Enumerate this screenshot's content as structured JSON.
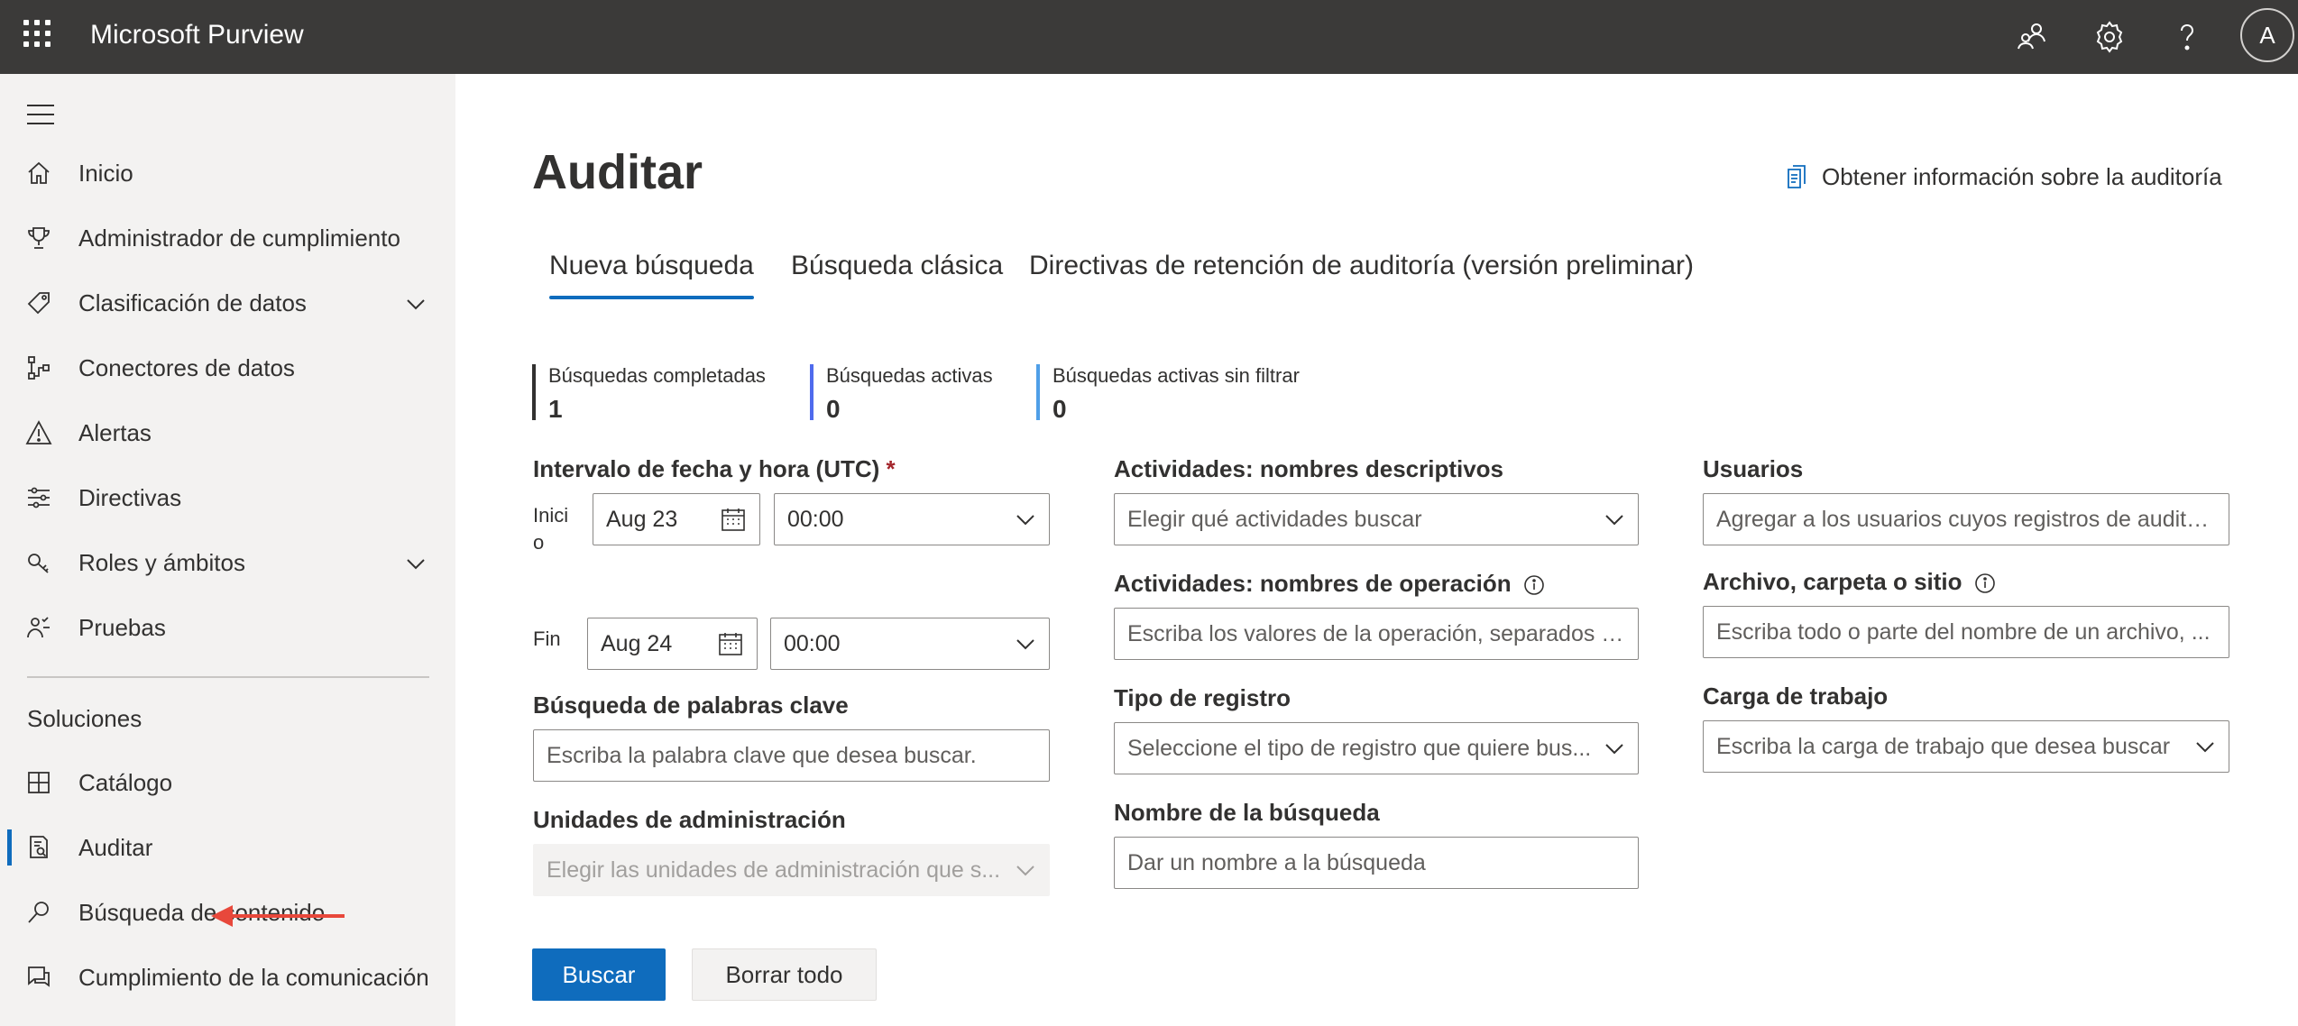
{
  "topbar": {
    "app_title": "Microsoft Purview",
    "icons": [
      "waffle-icon",
      "people-network-icon",
      "settings-gear-icon",
      "help-question-icon"
    ],
    "avatar_initial": "A"
  },
  "sidebar": {
    "items": [
      {
        "label": "Inicio",
        "icon": "home-icon"
      },
      {
        "label": "Administrador de cumplimiento",
        "icon": "trophy-icon"
      },
      {
        "label": "Clasificación de datos",
        "icon": "tag-icon",
        "expandable": true
      },
      {
        "label": "Conectores de datos",
        "icon": "connector-icon"
      },
      {
        "label": "Alertas",
        "icon": "warning-icon"
      },
      {
        "label": "Directivas",
        "icon": "sliders-icon"
      },
      {
        "label": "Roles y ámbitos",
        "icon": "key-icon",
        "expandable": true
      },
      {
        "label": "Pruebas",
        "icon": "trials-icon"
      }
    ],
    "section_label": "Soluciones",
    "solutions": [
      {
        "label": "Catálogo",
        "icon": "catalog-icon"
      },
      {
        "label": "Auditar",
        "icon": "audit-icon",
        "active": true
      },
      {
        "label": "Búsqueda de contenido",
        "icon": "search-icon"
      },
      {
        "label": "Cumplimiento de la comunicación",
        "icon": "chat-icon"
      }
    ]
  },
  "main": {
    "title": "Auditar",
    "learn_link": "Obtener información sobre la auditoría",
    "tabs": [
      {
        "label": "Nueva búsqueda",
        "active": true
      },
      {
        "label": "Búsqueda clásica"
      },
      {
        "label": "Directivas de retención de auditoría (versión preliminar)"
      }
    ],
    "stats": [
      {
        "label": "Búsquedas completadas",
        "value": "1",
        "color": "#323130"
      },
      {
        "label": "Búsquedas activas",
        "value": "0",
        "color": "#4f6bed"
      },
      {
        "label": "Búsquedas activas sin filtrar",
        "value": "0",
        "color": "#4f9fe8"
      }
    ],
    "date_range": {
      "label": "Intervalo de fecha y hora (UTC)",
      "required_mark": "*",
      "start_label": "Inici\no",
      "start_date": "Aug 23",
      "start_time": "00:00",
      "end_label": "Fin",
      "end_date": "Aug 24",
      "end_time": "00:00"
    },
    "keyword": {
      "label": "Búsqueda de palabras clave",
      "placeholder": "Escriba la palabra clave que desea buscar."
    },
    "admin_units": {
      "label": "Unidades de administración",
      "placeholder": "Elegir las unidades de administración que s..."
    },
    "activities_friendly": {
      "label": "Actividades: nombres descriptivos",
      "placeholder": "Elegir qué actividades buscar"
    },
    "activities_operation": {
      "label": "Actividades: nombres de operación",
      "placeholder": "Escriba los valores de la operación, separados p..."
    },
    "record_type": {
      "label": "Tipo de registro",
      "placeholder": "Seleccione el tipo de registro que quiere bus..."
    },
    "search_name": {
      "label": "Nombre de la búsqueda",
      "placeholder": "Dar un nombre a la búsqueda"
    },
    "users": {
      "label": "Usuarios",
      "placeholder": "Agregar a los usuarios cuyos registros de audito..."
    },
    "file_folder": {
      "label": "Archivo, carpeta o sitio",
      "placeholder": "Escriba todo o parte del nombre de un archivo, ..."
    },
    "workload": {
      "label": "Carga de trabajo",
      "placeholder": "Escriba la carga de trabajo que desea buscar"
    },
    "buttons": {
      "search": "Buscar",
      "clear": "Borrar todo"
    }
  },
  "colors": {
    "accent": "#0f6cbd",
    "topbar": "#3b3a39",
    "sidebar": "#f3f2f1",
    "annotation_arrow": "#e8483b"
  }
}
